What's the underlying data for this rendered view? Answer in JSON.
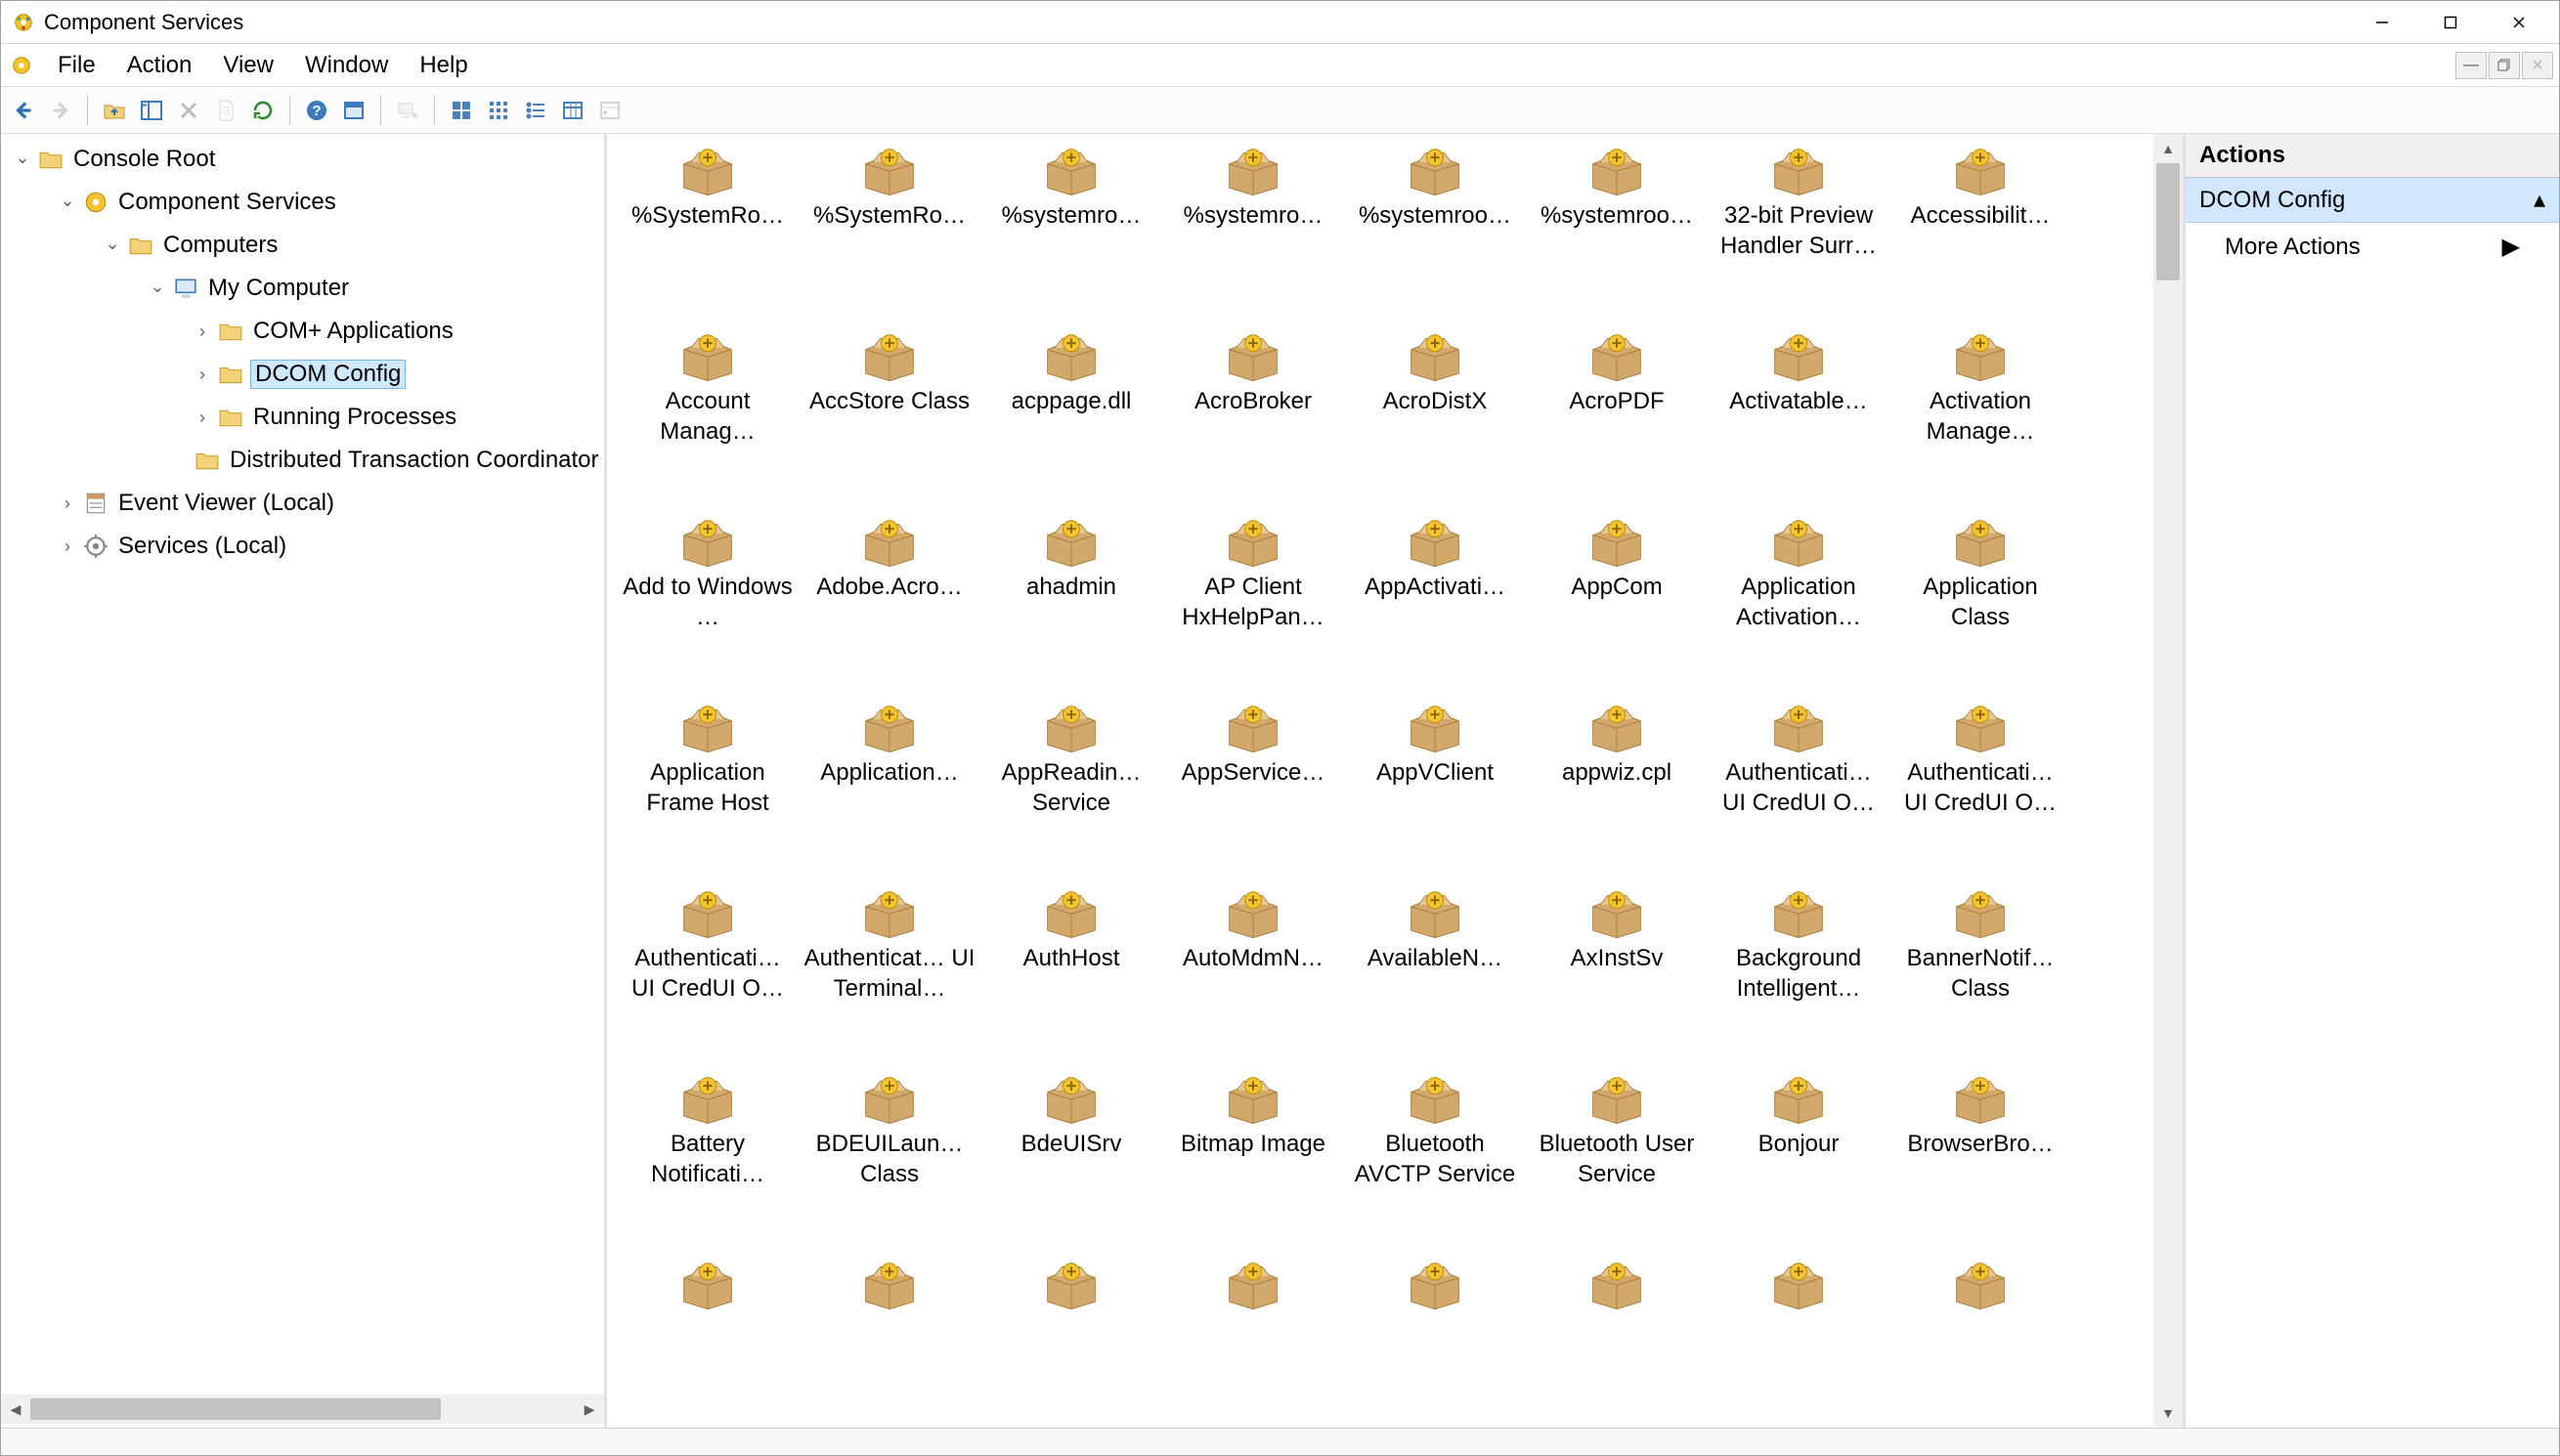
{
  "window": {
    "title": "Component Services"
  },
  "menubar": {
    "items": [
      "File",
      "Action",
      "View",
      "Window",
      "Help"
    ]
  },
  "toolbar": {
    "buttons": [
      {
        "name": "nav-back",
        "icon": "arrow-left",
        "disabled": false
      },
      {
        "name": "nav-forward",
        "icon": "arrow-right",
        "disabled": true
      },
      {
        "sep": true
      },
      {
        "name": "up-one-level",
        "icon": "folder-up",
        "disabled": false
      },
      {
        "name": "show-hide-tree",
        "icon": "tree-pane",
        "disabled": false
      },
      {
        "name": "delete",
        "icon": "x",
        "disabled": true
      },
      {
        "name": "properties",
        "icon": "page",
        "disabled": true
      },
      {
        "name": "refresh",
        "icon": "refresh",
        "disabled": false
      },
      {
        "sep": true
      },
      {
        "name": "help",
        "icon": "help",
        "disabled": false
      },
      {
        "name": "show-window",
        "icon": "window",
        "disabled": false
      },
      {
        "sep": true
      },
      {
        "name": "my-computer-connect",
        "icon": "computer-plug",
        "disabled": true
      },
      {
        "sep": true
      },
      {
        "name": "view-large",
        "icon": "grid-large",
        "disabled": false
      },
      {
        "name": "view-small",
        "icon": "grid-small",
        "disabled": false
      },
      {
        "name": "view-list",
        "icon": "list",
        "disabled": false
      },
      {
        "name": "view-details",
        "icon": "details",
        "disabled": false
      },
      {
        "name": "view-status",
        "icon": "status-view",
        "disabled": true
      }
    ]
  },
  "tree": [
    {
      "level": 0,
      "exp": "open",
      "icon": "folder",
      "label": "Console Root",
      "name": "console-root"
    },
    {
      "level": 1,
      "exp": "open",
      "icon": "comsvc",
      "label": "Component Services",
      "name": "component-services"
    },
    {
      "level": 2,
      "exp": "open",
      "icon": "folder",
      "label": "Computers",
      "name": "computers"
    },
    {
      "level": 3,
      "exp": "open",
      "icon": "computer",
      "label": "My Computer",
      "name": "my-computer"
    },
    {
      "level": 4,
      "exp": "closed",
      "icon": "folder",
      "label": "COM+ Applications",
      "name": "com-applications"
    },
    {
      "level": 4,
      "exp": "closed",
      "icon": "folder",
      "label": "DCOM Config",
      "name": "dcom-config",
      "selected": true
    },
    {
      "level": 4,
      "exp": "closed",
      "icon": "folder",
      "label": "Running Processes",
      "name": "running-processes"
    },
    {
      "level": 4,
      "exp": "none",
      "icon": "folder",
      "label": "Distributed Transaction Coordinator",
      "name": "dtc"
    },
    {
      "level": 1,
      "exp": "closed",
      "icon": "eventvwr",
      "label": "Event Viewer (Local)",
      "name": "event-viewer"
    },
    {
      "level": 1,
      "exp": "closed",
      "icon": "services",
      "label": "Services (Local)",
      "name": "services-local"
    }
  ],
  "grid_items": [
    "%SystemRo…",
    "%SystemRo…",
    "%systemro…",
    "%systemro…",
    "%systemroo…",
    "%systemroo…",
    "32-bit Preview Handler Surr…",
    "Accessibilit…",
    "Account Manag…",
    "AccStore Class",
    "acppage.dll",
    "AcroBroker",
    "AcroDistX",
    "AcroPDF",
    "Activatable…",
    "Activation Manage…",
    "Add to Windows …",
    "Adobe.Acro…",
    "ahadmin",
    "AP Client HxHelpPan…",
    "AppActivati…",
    "AppCom",
    "Application Activation…",
    "Application Class",
    "Application Frame Host",
    "Application…",
    "AppReadin… Service",
    "AppService…",
    "AppVClient",
    "appwiz.cpl",
    "Authenticati… UI CredUI O…",
    "Authenticati… UI CredUI O…",
    "Authenticati… UI CredUI O…",
    "Authenticat… UI Terminal…",
    "AuthHost",
    "AutoMdmN…",
    "AvailableN…",
    "AxInstSv",
    "Background Intelligent…",
    "BannerNotif… Class",
    "Battery Notificati…",
    "BDEUILaun… Class",
    "BdeUISrv",
    "Bitmap Image",
    "Bluetooth AVCTP Service",
    "Bluetooth User Service",
    "Bonjour",
    "BrowserBro…",
    "",
    "",
    "",
    "",
    "",
    "",
    "",
    ""
  ],
  "actions": {
    "header": "Actions",
    "section_title": "DCOM Config",
    "more": "More Actions"
  }
}
